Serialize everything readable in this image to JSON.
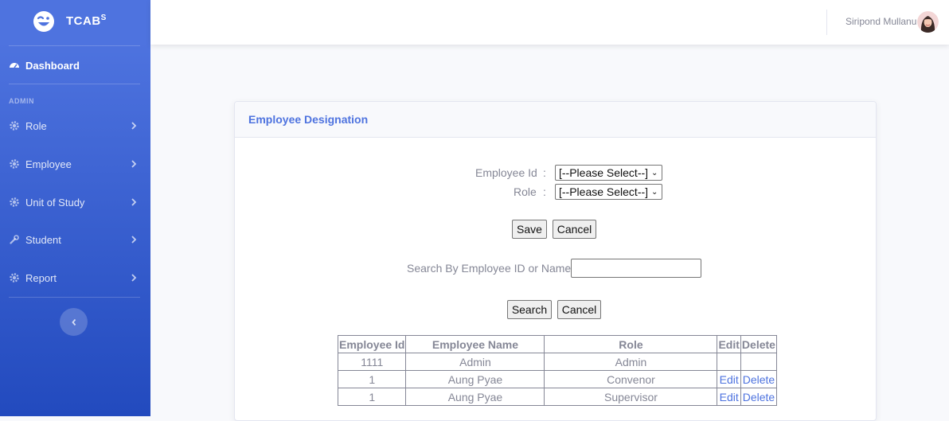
{
  "brand": {
    "name": "TCAB",
    "superscript": "S"
  },
  "sidebar": {
    "dashboard": {
      "label": "Dashboard",
      "icon": "tachometer-icon"
    },
    "section_heading": "ADMIN",
    "items": [
      {
        "label": "Role",
        "icon": "gear-icon"
      },
      {
        "label": "Employee",
        "icon": "gear-icon"
      },
      {
        "label": "Unit of Study",
        "icon": "gear-icon"
      },
      {
        "label": "Student",
        "icon": "wrench-icon"
      },
      {
        "label": "Report",
        "icon": "gear-icon"
      }
    ]
  },
  "topbar": {
    "user_name": "Siripond Mullanu"
  },
  "card": {
    "title": "Employee Designation"
  },
  "form": {
    "employee_id_label": "Employee Id",
    "role_label": "Role",
    "colon": ":",
    "employee_id_select": "[--Please Select--]",
    "role_select": "[--Please Select--]",
    "save_label": "Save",
    "cancel_label": "Cancel"
  },
  "search": {
    "label": "Search By Employee ID or Name",
    "colon": ":",
    "value": "",
    "search_label": "Search",
    "cancel_label": "Cancel"
  },
  "table": {
    "headers": [
      "Employee Id",
      "Employee Name",
      "Role",
      "Edit",
      "Delete"
    ],
    "rows": [
      {
        "id": "1111",
        "name": "Admin",
        "role": "Admin",
        "edit": "",
        "delete": ""
      },
      {
        "id": "1",
        "name": "Aung Pyae",
        "role": "Convenor",
        "edit": "Edit",
        "delete": "Delete"
      },
      {
        "id": "1",
        "name": "Aung Pyae",
        "role": "Supervisor",
        "edit": "Edit",
        "delete": "Delete"
      }
    ]
  },
  "colors": {
    "primary": "#4e73df",
    "sidebar_end": "#224abe",
    "muted_text": "#858796"
  }
}
